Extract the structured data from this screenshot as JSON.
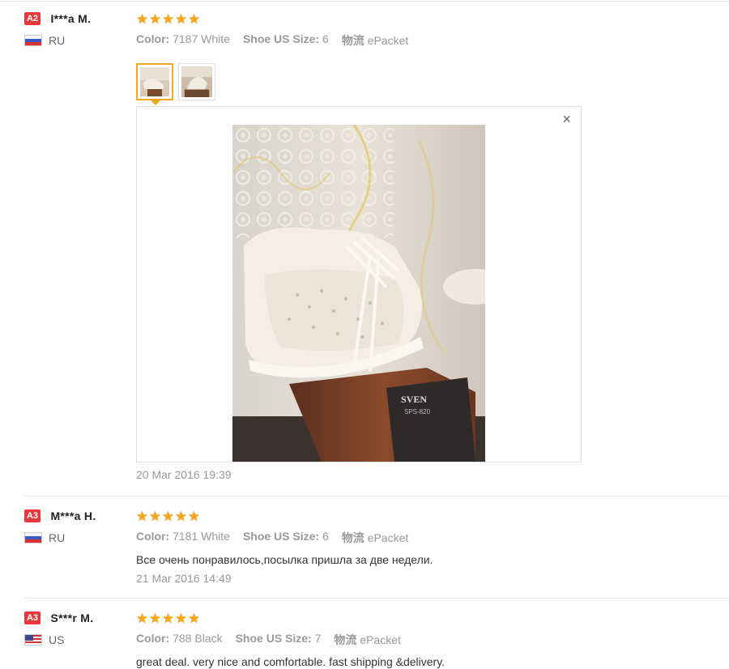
{
  "reviews": [
    {
      "level": "A2",
      "user": "I***a M.",
      "country": "RU",
      "rating": 5,
      "attrs": [
        {
          "key": "Color:",
          "value": "7187 White"
        },
        {
          "key": "Shoe US Size:",
          "value": "6"
        },
        {
          "key": "物流",
          "value": "ePacket"
        }
      ],
      "date": "20 Mar 2016 19:39"
    },
    {
      "level": "A3",
      "user": "M***a H.",
      "country": "RU",
      "rating": 5,
      "attrs": [
        {
          "key": "Color:",
          "value": "7181 White"
        },
        {
          "key": "Shoe US Size:",
          "value": "6"
        },
        {
          "key": "物流",
          "value": "ePacket"
        }
      ],
      "feedback": "Все очень понравилось,посылка пришла за две недели.",
      "date": "21 Mar 2016 14:49"
    },
    {
      "level": "A3",
      "user": "S***r M.",
      "country": "US",
      "rating": 5,
      "attrs": [
        {
          "key": "Color:",
          "value": "788 Black"
        },
        {
          "key": "Shoe US Size:",
          "value": "7"
        },
        {
          "key": "物流",
          "value": "ePacket"
        }
      ],
      "feedback": "great deal. very nice and comfortable. fast shipping &delivery."
    }
  ],
  "viewer": {
    "close_label": "×",
    "close_icon": "close-icon",
    "photo_brand_text": "SVEN",
    "photo_model_text": "SPS-820"
  },
  "colors": {
    "star": "#f5a623",
    "level_badge": "#e4393c",
    "active_thumb_border": "#f5a623"
  }
}
